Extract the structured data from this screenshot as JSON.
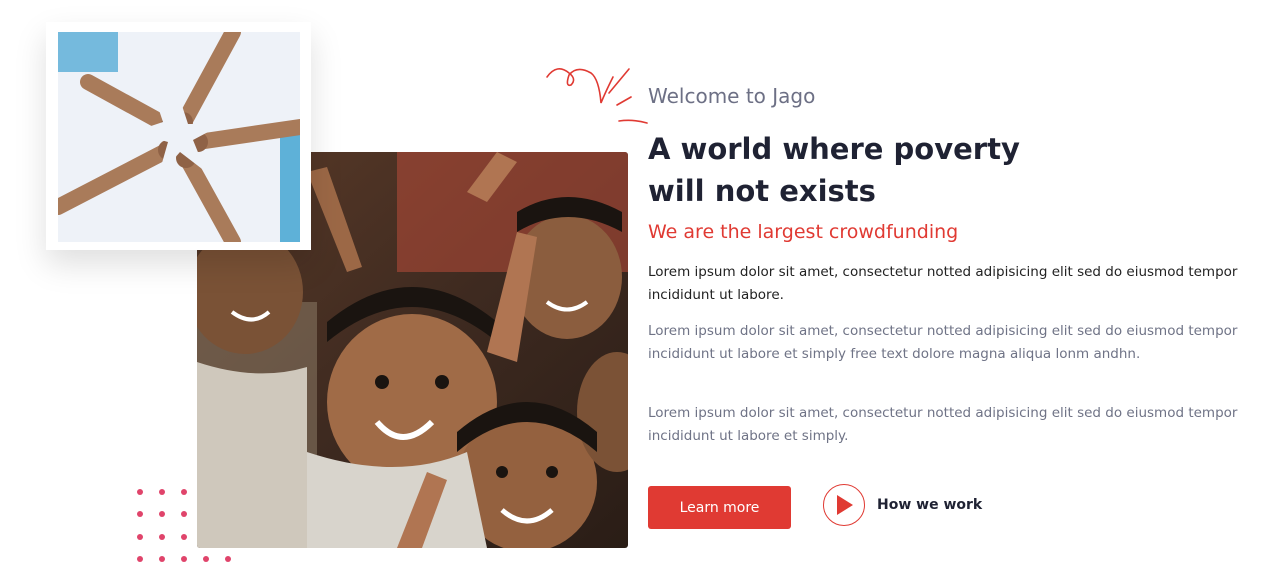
{
  "about": {
    "welcome": "Welcome to Jago",
    "headline_line1_prefix": "A world where ",
    "headline_highlight": "poverty",
    "headline_line2": "will not exists",
    "subheading": "We are the largest crowdfunding",
    "paragraphs": [
      "Lorem ipsum dolor sit amet, consectetur notted adipisicing elit sed do eiusmod tempor incididunt ut labore.",
      "Lorem ipsum dolor sit amet, consectetur notted adipisicing elit sed do eiusmod tempor incididunt ut labore et simply free text dolore magna aliqua lonm andhn.",
      "Lorem ipsum dolor sit amet, consectetur notted adipisicing elit sed do eiusmod tempor incididunt ut labore et simply."
    ],
    "learn_more_label": "Learn more",
    "how_we_work_label": "How we work"
  },
  "images": {
    "main_photo": "children-smiling-photo",
    "framed_photo": "hands-star-photo"
  },
  "colors": {
    "accent": "#e03a33",
    "highlight": "#ffc62d",
    "dots": "#e0446b",
    "text_dark": "#1f2233",
    "text_muted": "#6f7386"
  }
}
